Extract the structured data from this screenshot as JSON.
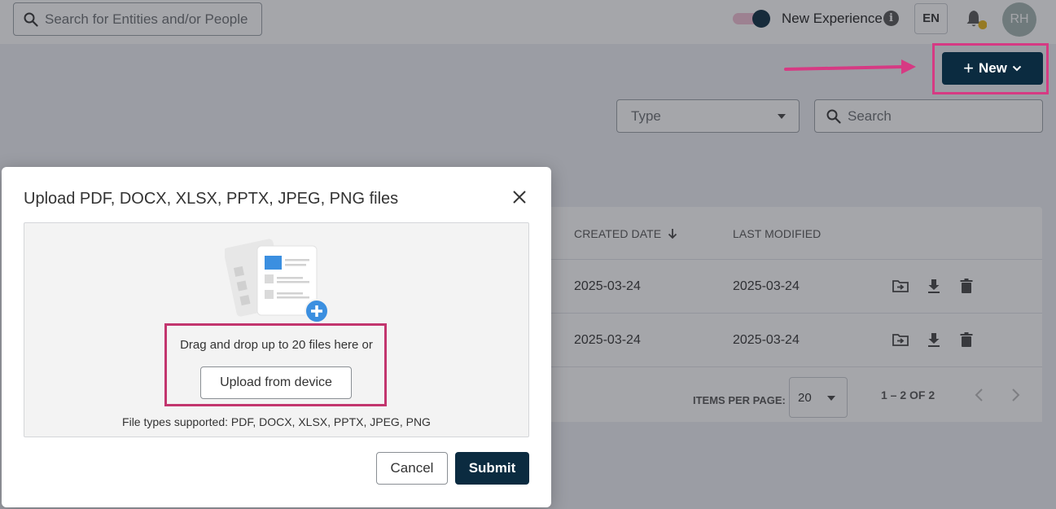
{
  "topbar": {
    "search_placeholder": "Search for Entities and/or People",
    "toggle_label": "New Experience",
    "toggle_on": true,
    "language": "EN",
    "avatar_initials": "RH"
  },
  "toolbar": {
    "new_label": "New",
    "type_placeholder": "Type",
    "search_placeholder": "Search"
  },
  "table": {
    "columns": [
      "CREATED DATE",
      "LAST MODIFIED"
    ],
    "rows": [
      {
        "created": "2025-03-24",
        "modified": "2025-03-24"
      },
      {
        "created": "2025-03-24",
        "modified": "2025-03-24"
      }
    ]
  },
  "pagination": {
    "items_per_page_label": "ITEMS PER PAGE:",
    "items_per_page": "20",
    "range": "1 – 2 OF 2"
  },
  "modal": {
    "title": "Upload PDF, DOCX, XLSX, PPTX, JPEG, PNG files",
    "drop_hint": "Drag and drop up to 20 files here or",
    "upload_label": "Upload from device",
    "types_supported": "File types supported: PDF, DOCX, XLSX, PPTX, JPEG, PNG",
    "cancel_label": "Cancel",
    "submit_label": "Submit"
  },
  "colors": {
    "primary": "#0b2b40",
    "annotation": "#d63a83",
    "accent_blue": "#3b8fe0",
    "notification_dot": "#e6b417"
  }
}
